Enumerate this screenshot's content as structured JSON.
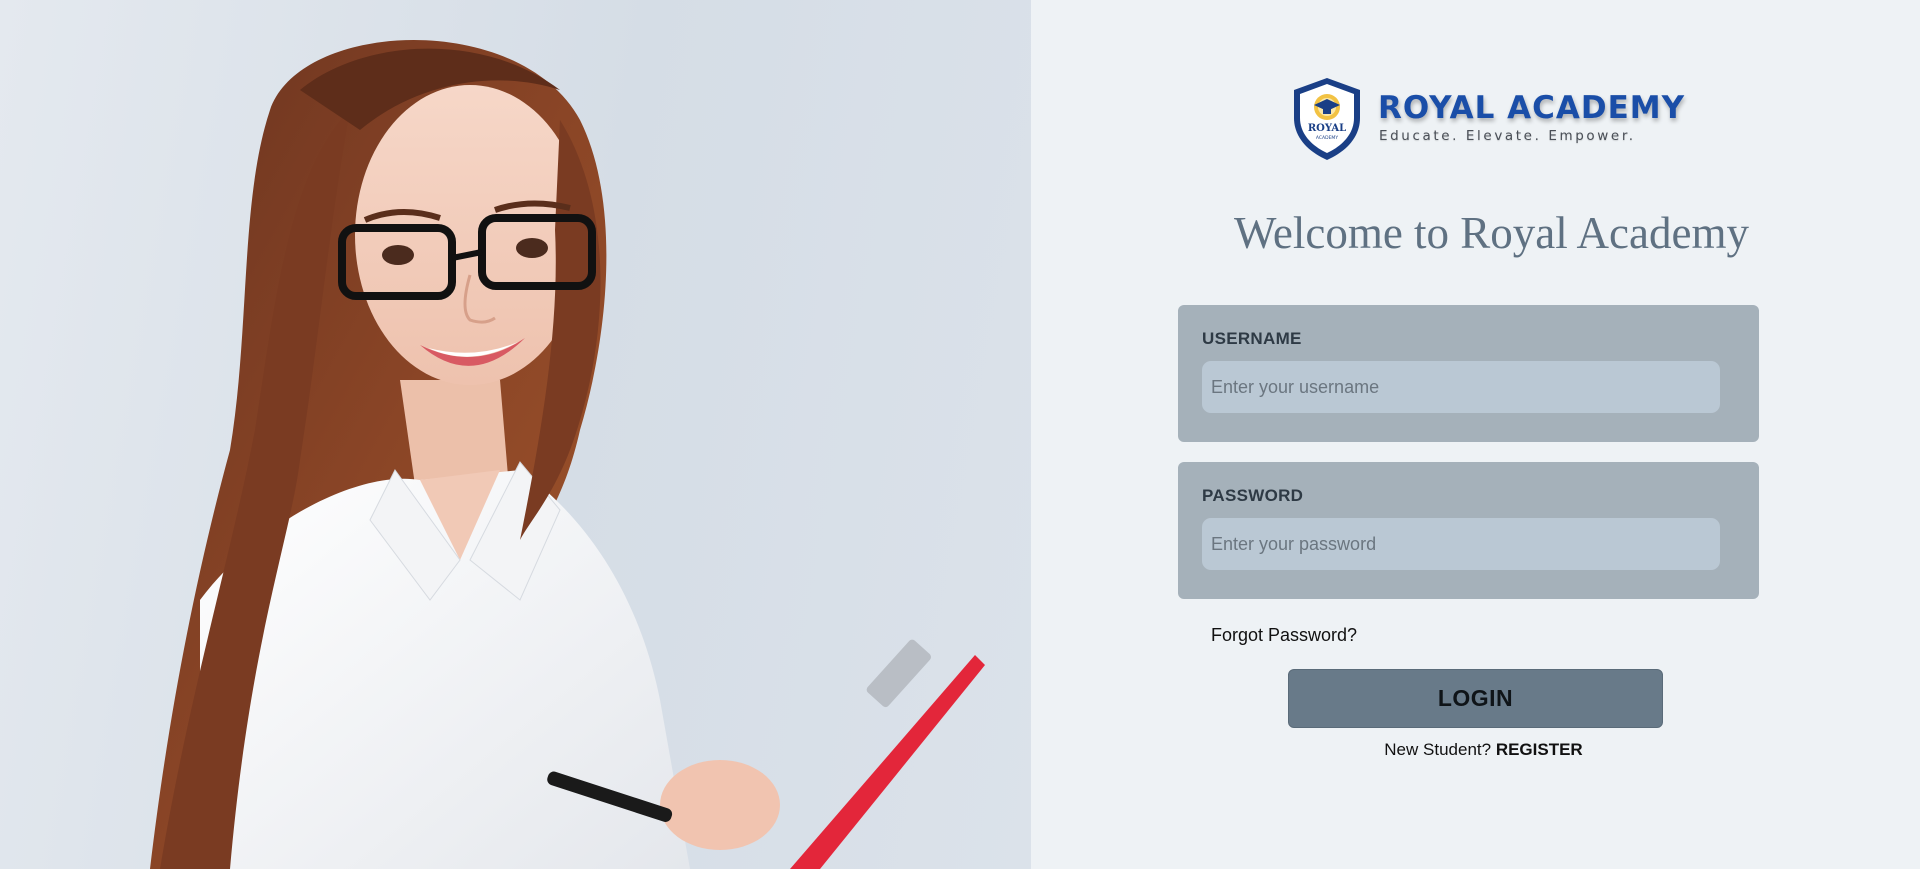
{
  "brand": {
    "name": "ROYAL ACADEMY",
    "tagline": "Educate. Elevate. Empower.",
    "shield_text_top": "ROYAL",
    "shield_text_bottom": "ACADEMY",
    "color": "#1a4ea8"
  },
  "welcome": "Welcome to Royal Academy",
  "form": {
    "username": {
      "label": "USERNAME",
      "value": "",
      "placeholder": "Enter your username"
    },
    "password": {
      "label": "PASSWORD",
      "value": "",
      "placeholder": "Enter your password"
    },
    "forgot_label": "Forgot Password?",
    "login_label": "LOGIN",
    "register_prompt": "New Student?",
    "register_label": "REGISTER"
  },
  "hero": {
    "icon": "student-photo-icon"
  },
  "colors": {
    "panel_bg": "#eef2f5",
    "card_bg": "#a5b1ba",
    "input_bg": "#bac8d4",
    "button_bg": "#687a89",
    "welcome_text": "#5f7182"
  }
}
